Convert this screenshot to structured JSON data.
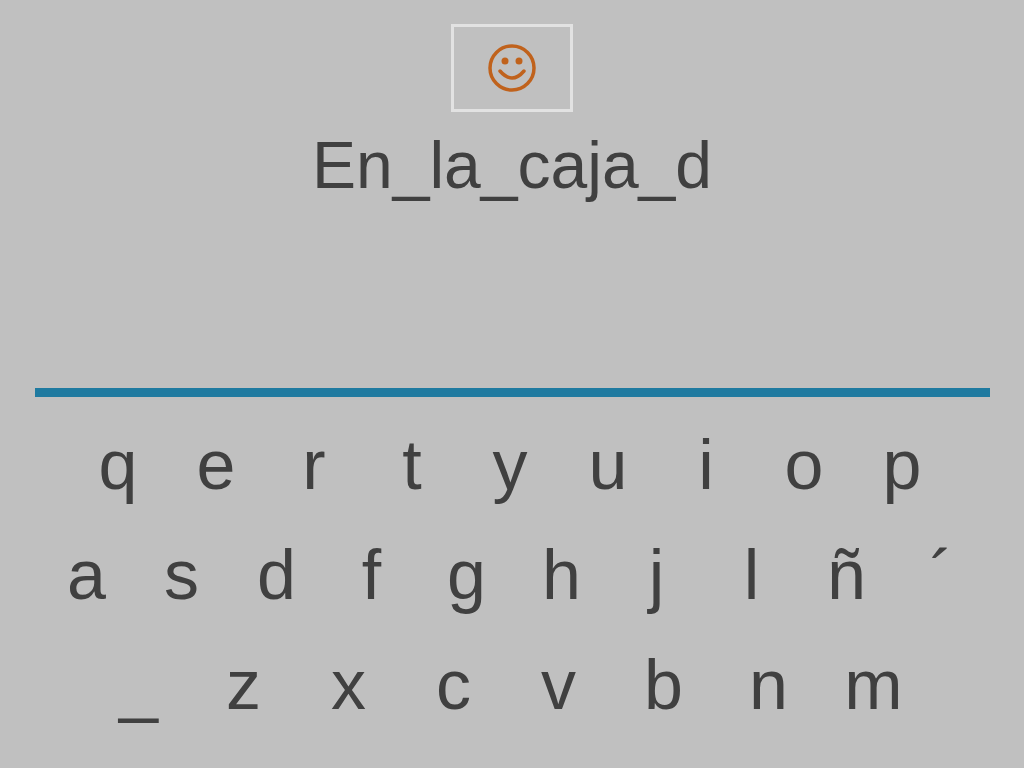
{
  "prompt": "En_la_caja_d",
  "keyboard": [
    [
      "q",
      "e",
      "r",
      "t",
      "y",
      "u",
      "i",
      "o",
      "p"
    ],
    [
      "a",
      "s",
      "d",
      "f",
      "g",
      "h",
      "j",
      "l",
      "ñ",
      "´"
    ],
    [
      "_",
      "z",
      "x",
      "c",
      "v",
      "b",
      "n",
      "m"
    ]
  ]
}
